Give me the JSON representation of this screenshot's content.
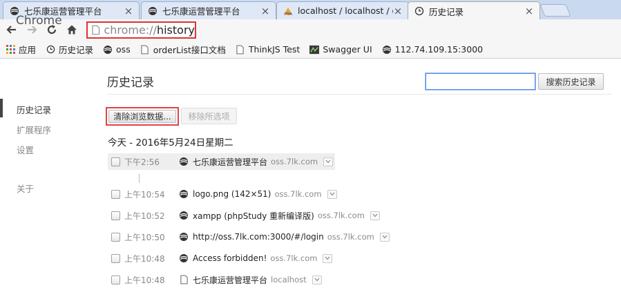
{
  "browser": {
    "tabs": [
      {
        "title": "七乐康运营管理平台",
        "icon": "swirl-logo-icon",
        "close": "×"
      },
      {
        "title": "七乐康运营管理平台",
        "icon": "swirl-logo-icon",
        "close": "×"
      },
      {
        "title": "localhost / localhost / of",
        "icon": "phpmyadmin-icon",
        "close": "×"
      },
      {
        "title": "历史记录",
        "icon": "history-icon",
        "close": "×"
      }
    ],
    "address": {
      "scheme": "chrome://",
      "path": "history"
    }
  },
  "bookmarks": [
    {
      "label": "应用",
      "icon": "apps-grid-icon"
    },
    {
      "label": "历史记录",
      "icon": "history-icon"
    },
    {
      "label": "oss",
      "icon": "swirl-logo-icon"
    },
    {
      "label": "orderList接口文档",
      "icon": "page-icon"
    },
    {
      "label": "ThinkJS Test",
      "icon": "page-icon"
    },
    {
      "label": "Swagger UI",
      "icon": "swagger-icon"
    },
    {
      "label": "112.74.109.15:3000",
      "icon": "swirl-logo-icon"
    }
  ],
  "sidebar": {
    "title": "Chrome",
    "items": [
      {
        "label": "历史记录",
        "active": true
      },
      {
        "label": "扩展程序",
        "active": false
      },
      {
        "label": "设置",
        "active": false
      },
      {
        "label": "关于",
        "active": false
      }
    ]
  },
  "main": {
    "title": "历史记录",
    "search_button": "搜索历史记录",
    "clear_button": "清除浏览数据...",
    "remove_button": "移除所选项",
    "day_header": "今天 - 2016年5月24日星期二",
    "entries": [
      {
        "time": "下午2:56",
        "title": "七乐康运营管理平台",
        "domain": "oss.7lk.com",
        "icon": "swirl-logo-icon"
      },
      {
        "time": "上午10:54",
        "title": "logo.png (142×51)",
        "domain": "oss.7lk.com",
        "icon": "swirl-logo-icon"
      },
      {
        "time": "上午10:52",
        "title": "xampp (phpStudy 重新编译版)",
        "domain": "oss.7lk.com",
        "icon": "swirl-logo-icon"
      },
      {
        "time": "上午10:50",
        "title": "http://oss.7lk.com:3000/#/login",
        "domain": "oss.7lk.com",
        "icon": "swirl-logo-icon"
      },
      {
        "time": "上午10:48",
        "title": "Access forbidden!",
        "domain": "oss.7lk.com",
        "icon": "swirl-logo-icon"
      },
      {
        "time": "上午10:48",
        "title": "七乐康运营管理平台",
        "domain": "localhost",
        "icon": "page-icon"
      }
    ]
  }
}
